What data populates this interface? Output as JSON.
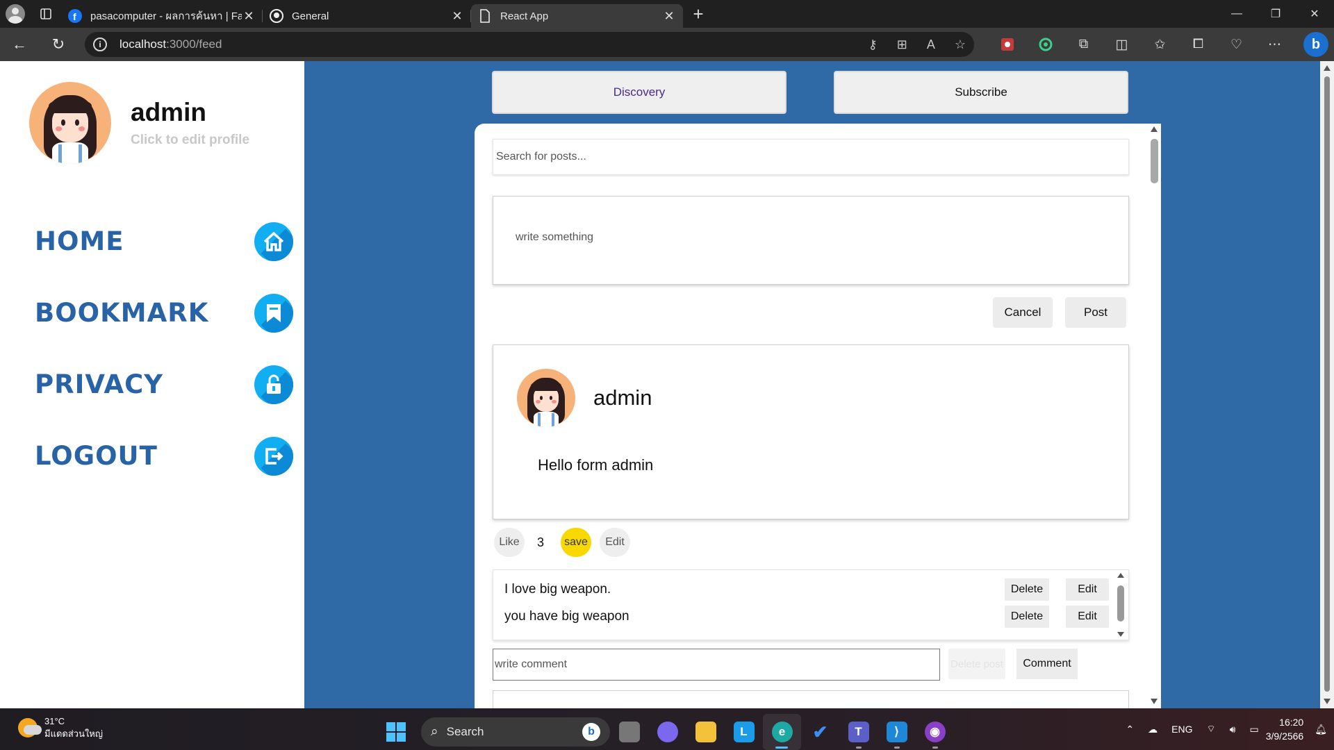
{
  "browser": {
    "tabs": [
      {
        "label": "pasacomputer - ผลการค้นหา | Facebook",
        "icon": "facebook-icon"
      },
      {
        "label": "General",
        "icon": "github-icon"
      },
      {
        "label": "React App",
        "icon": "page-icon"
      }
    ],
    "url_host": "localhost",
    "url_path": ":3000/feed"
  },
  "sidebar": {
    "profile": {
      "name": "admin",
      "subtitle": "Click to edit profile"
    },
    "menu": [
      {
        "label": "HOME",
        "icon": "home-icon"
      },
      {
        "label": "BOOKMARK",
        "icon": "bookmark-icon"
      },
      {
        "label": "PRIVACY",
        "icon": "lock-icon"
      },
      {
        "label": "LOGOUT",
        "icon": "logout-icon"
      }
    ]
  },
  "top_buttons": {
    "discovery": "Discovery",
    "subscribe": "Subscribe"
  },
  "feed": {
    "search_placeholder": "Search for posts...",
    "compose_placeholder": "write something",
    "cancel_label": "Cancel",
    "post_label": "Post",
    "post": {
      "author": "admin",
      "text": "Hello form admin",
      "like_label": "Like",
      "like_count": "3",
      "save_label": "save",
      "edit_label": "Edit"
    },
    "comments": [
      {
        "text": "I love big weapon.",
        "delete_label": "Delete",
        "edit_label": "Edit"
      },
      {
        "text": "you have big weapon",
        "delete_label": "Delete",
        "edit_label": "Edit"
      }
    ],
    "comment_placeholder": "write comment",
    "delete_post_label": "Delete post",
    "comment_button": "Comment"
  },
  "taskbar": {
    "weather_temp": "31°C",
    "weather_desc": "มีแดดส่วนใหญ่",
    "search_label": "Search",
    "language": "ENG",
    "time": "16:20",
    "date": "3/9/2566"
  },
  "colors": {
    "page_bg": "#306aa6",
    "menu_text": "#2763a6",
    "menu_icon": "#11aef2",
    "save_pill": "#f9d800"
  }
}
